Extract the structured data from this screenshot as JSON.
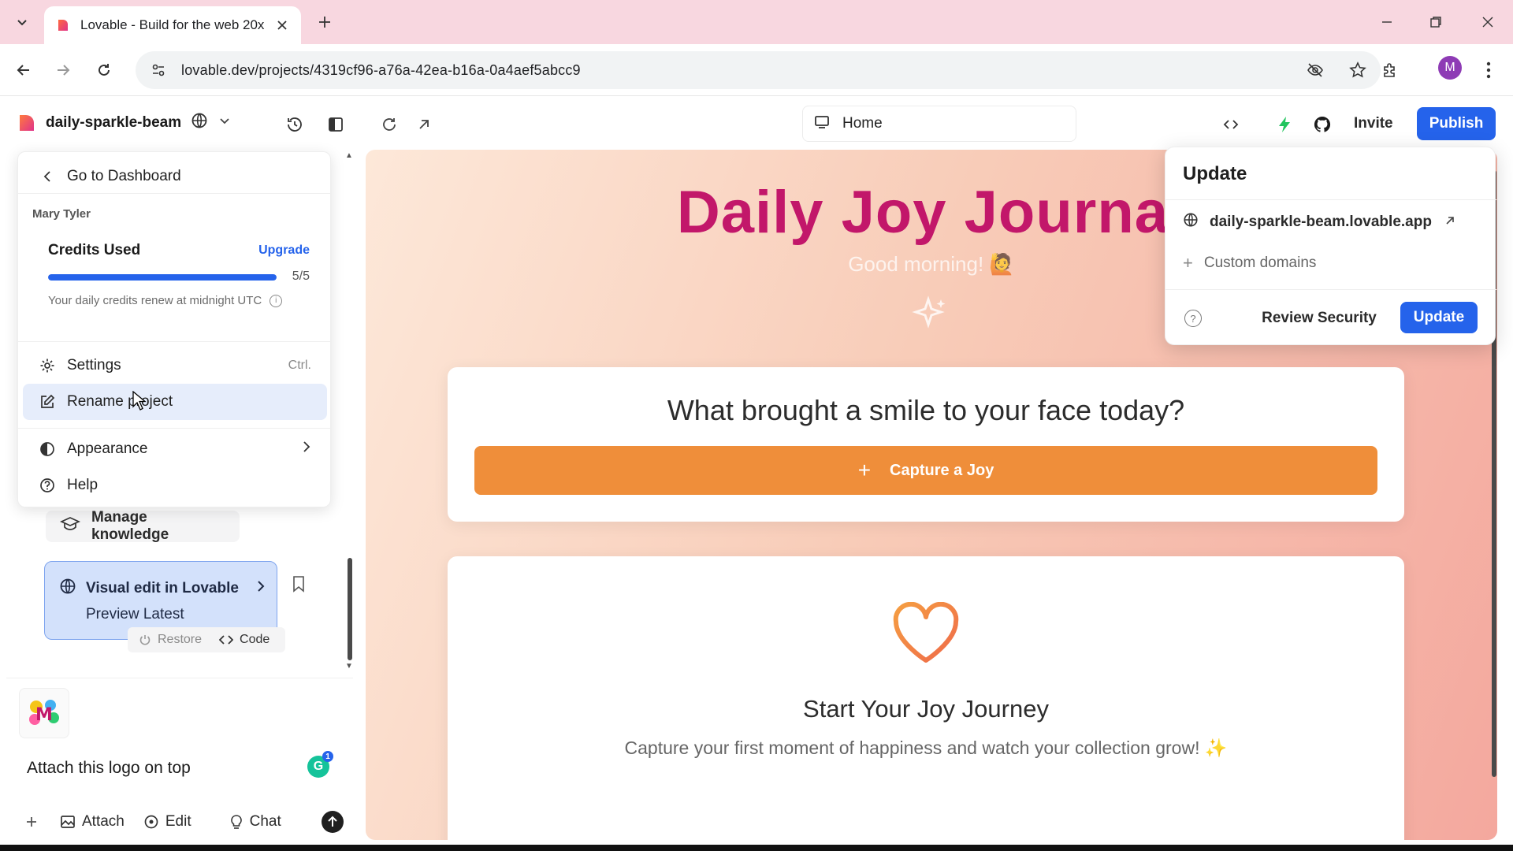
{
  "browser": {
    "tab_title": "Lovable - Build for the web 20x",
    "url": "lovable.dev/projects/4319cf96-a76a-42ea-b16a-0a4aef5abcc9",
    "profile_initial": "M"
  },
  "header": {
    "project_name": "daily-sparkle-beam",
    "route": "Home",
    "invite_label": "Invite",
    "publish_label": "Publish"
  },
  "menu": {
    "back_label": "Go to Dashboard",
    "user_name": "Mary Tyler",
    "credits": {
      "title": "Credits Used",
      "upgrade_label": "Upgrade",
      "count": "5/5",
      "progress": 1.0,
      "note": "Your daily credits renew at midnight UTC"
    },
    "items": [
      {
        "label": "Settings",
        "shortcut": "Ctrl."
      },
      {
        "label": "Rename project"
      },
      {
        "label": "Appearance"
      },
      {
        "label": "Help"
      }
    ]
  },
  "chat": {
    "manage_knowledge": "Manage knowledge",
    "visual_edit_title": "Visual edit in Lovable",
    "visual_edit_sub": "Preview Latest",
    "restore_label": "Restore",
    "code_label": "Code",
    "thumb_letter": "M",
    "composer_text": "Attach this logo on top",
    "attach_label": "Attach",
    "edit_label": "Edit",
    "chat_label": "Chat",
    "grammarly_letter": "G",
    "grammarly_badge": "1"
  },
  "preview": {
    "title": "Daily Joy Journal",
    "greeting": "Good morning! 🙋",
    "question": "What brought a smile to your face today?",
    "cta_plus": "+",
    "cta_label": "Capture a Joy",
    "empty_title": "Start Your Joy Journey",
    "empty_text": "Capture your first moment of happiness and watch your collection grow! ✨"
  },
  "popover": {
    "title": "Update",
    "domain": "daily-sparkle-beam.lovable.app",
    "custom_domains": "Custom domains",
    "help_glyph": "?",
    "review_security": "Review Security",
    "update_label": "Update"
  },
  "colors": {
    "accent": "#2563eb",
    "title_magenta": "#c2176a",
    "cta_orange": "#ef8e3a",
    "tabbar_pink": "#f8d7e0"
  }
}
